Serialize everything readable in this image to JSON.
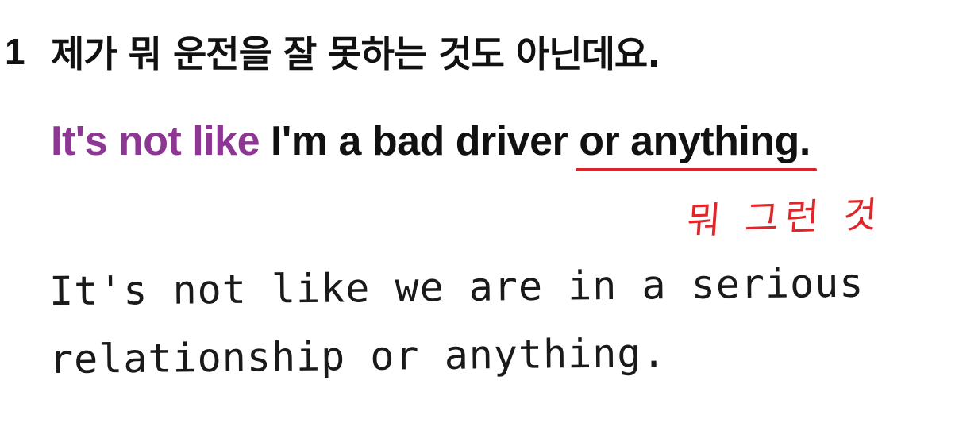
{
  "item_number": "1",
  "korean_sentence": "제가 뭐 운전을 잘 못하는 것도 아닌데요.",
  "english_sentence": {
    "highlight": "It's not like",
    "middle": " I'm a bad driver ",
    "underlined": "or anything."
  },
  "annotation": "뭐 그런 것",
  "handwritten_example": {
    "line1": "It's not like we are in a serious",
    "line2": "relationship or anything."
  },
  "colors": {
    "highlight": "#8e3693",
    "annotation": "#e0262b",
    "underline": "#d9262c",
    "text": "#111111"
  }
}
